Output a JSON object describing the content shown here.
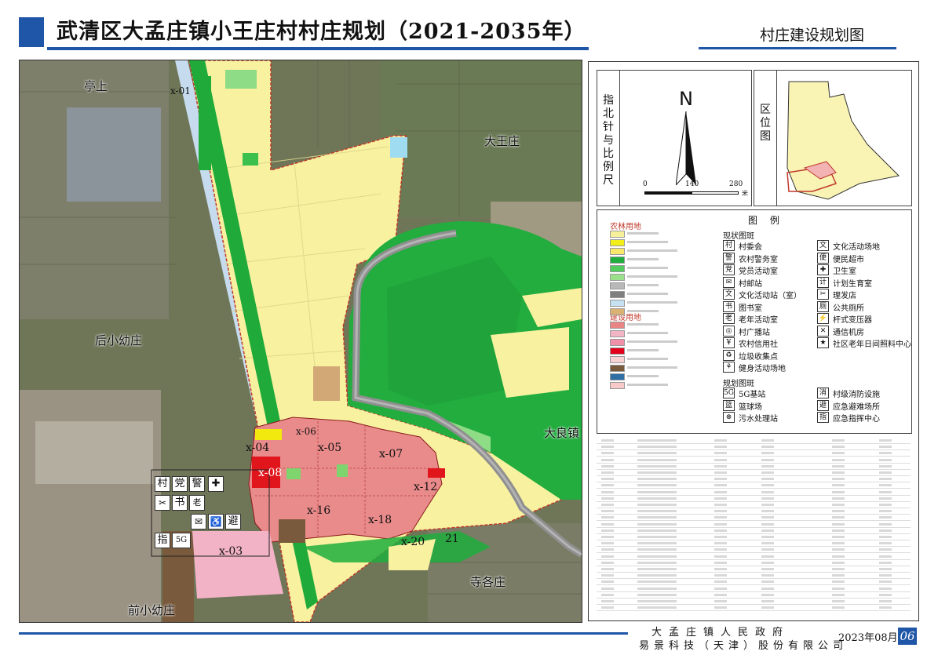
{
  "title": "武清区大孟庄镇小王庄村村庄规划（2021-2035年）",
  "subtitle": "村庄建设规划图",
  "map": {
    "place_labels": [
      "亭上",
      "大王庄",
      "后小幼庄",
      "大良镇",
      "寺各庄",
      "前小幼庄"
    ],
    "plot_labels": [
      "x-01",
      "x-03",
      "x-04",
      "x-05",
      "x-06",
      "x-07",
      "x-08",
      "x-12",
      "x-16",
      "x-18",
      "x-20",
      "21"
    ],
    "icon_panel": [
      "村",
      "党",
      "警",
      "书",
      "老",
      "避",
      "指",
      "5G"
    ]
  },
  "compass": {
    "label": "指北针与比例尺",
    "north": "N",
    "scale": [
      "0",
      "140",
      "280"
    ],
    "unit": "米"
  },
  "location": {
    "label": "区位图"
  },
  "legend": {
    "title": "图 例",
    "farm_head": "农林用地",
    "build_head": "建设用地",
    "current_head": "现状图斑",
    "plan_head": "规划图斑",
    "farm_items": [
      {
        "color": "#f6f09a"
      },
      {
        "color": "#f2ee1a"
      },
      {
        "color": "#f7e76a"
      },
      {
        "color": "#1fae3d"
      },
      {
        "color": "#51cc5d"
      },
      {
        "color": "#9ce08c"
      },
      {
        "color": "#b9b9b9"
      },
      {
        "color": "#7f7f7f"
      },
      {
        "color": "#c6e1f2"
      },
      {
        "color": "#d9b173"
      }
    ],
    "build_items": [
      {
        "color": "#e98585"
      },
      {
        "color": "#f3b4c6"
      },
      {
        "color": "#f190a9"
      },
      {
        "color": "#e2001a"
      },
      {
        "color": "#f7d3d3"
      },
      {
        "color": "#7a5a3c"
      },
      {
        "color": "#2f6fa4"
      },
      {
        "color": "#f7c9c9"
      }
    ],
    "current_icons": [
      {
        "icon": "村",
        "label": "村委会"
      },
      {
        "icon": "警",
        "label": "农村警务室"
      },
      {
        "icon": "党",
        "label": "党员活动室"
      },
      {
        "icon": "✉",
        "label": "村邮站"
      },
      {
        "icon": "文",
        "label": "文化活动站（室）"
      },
      {
        "icon": "书",
        "label": "图书室"
      },
      {
        "icon": "老",
        "label": "老年活动室"
      },
      {
        "icon": "◎",
        "label": "村广播站"
      },
      {
        "icon": "¥",
        "label": "农村信用社"
      },
      {
        "icon": "♻",
        "label": "垃圾收集点"
      },
      {
        "icon": "⚘",
        "label": "健身活动场地"
      }
    ],
    "current_icons_right": [
      {
        "icon": "文",
        "label": "文化活动场地"
      },
      {
        "icon": "便",
        "label": "便民超市"
      },
      {
        "icon": "✚",
        "label": "卫生室"
      },
      {
        "icon": "计",
        "label": "计划生育室"
      },
      {
        "icon": "✂",
        "label": "理发店"
      },
      {
        "icon": "厕",
        "label": "公共厕所"
      },
      {
        "icon": "⚡",
        "label": "杆式变压器"
      },
      {
        "icon": "✕",
        "label": "通信机房"
      },
      {
        "icon": "★",
        "label": "社区老年日间照料中心"
      }
    ],
    "plan_icons": [
      {
        "icon": "5G",
        "label": "5G基站"
      },
      {
        "icon": "篮",
        "label": "篮球场"
      },
      {
        "icon": "⊗",
        "label": "污水处理站"
      }
    ],
    "plan_icons_right": [
      {
        "icon": "消",
        "label": "村级消防设施"
      },
      {
        "icon": "避",
        "label": "应急避难场所"
      },
      {
        "icon": "指",
        "label": "应急指挥中心"
      }
    ]
  },
  "footer": {
    "org1": "大孟庄镇人民政府",
    "org2": "易景科技（天津）股份有限公司",
    "date": "2023年08月",
    "page": "06"
  }
}
